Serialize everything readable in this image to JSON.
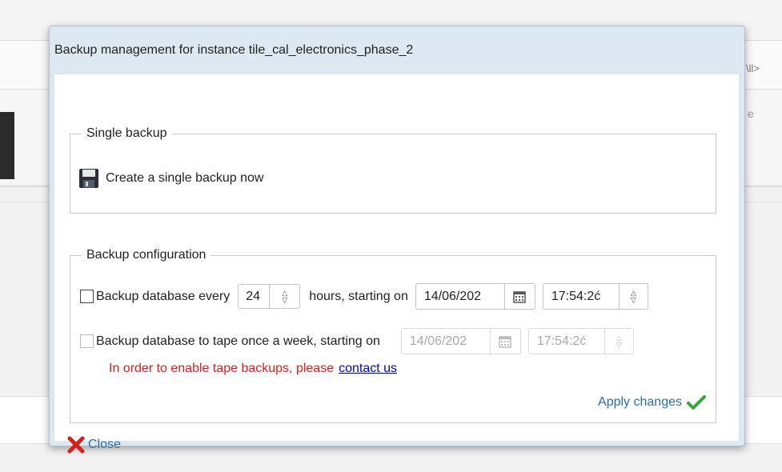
{
  "background": {
    "right_link_text": "\\ll>",
    "right_text_2": "e"
  },
  "dialog": {
    "title": "Backup management for instance tile_cal_electronics_phase_2",
    "close_label": "Close"
  },
  "single_backup": {
    "legend": "Single backup",
    "create_label": "Create a single backup now",
    "icon": "floppy-disk-icon"
  },
  "backup_config": {
    "legend": "Backup configuration",
    "periodic": {
      "checked": false,
      "label": "Backup database every",
      "hours_value": "24",
      "hours_suffix": "hours, starting on",
      "date_value": "14/06/202",
      "time_value": "17:54:2ć"
    },
    "tape": {
      "checked": false,
      "enabled": false,
      "label": "Backup database to tape once a week, starting on",
      "date_value": "14/06/202",
      "time_value": "17:54:2ć"
    },
    "tape_warning": "In order to enable tape backups, please",
    "contact_link": "contact us",
    "apply_label": "Apply changes"
  },
  "colors": {
    "warning": "#e01b1b",
    "link": "#0000cc",
    "action_link": "#2e6ea8",
    "apply_check": "#3aa63a",
    "close_x": "#d42020",
    "dialog_header": "#dde8f2"
  }
}
